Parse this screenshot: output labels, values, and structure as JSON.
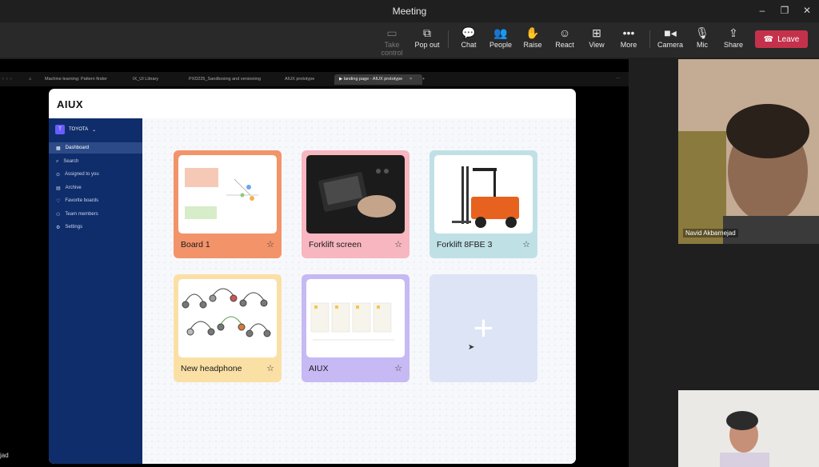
{
  "window": {
    "title": "Meeting",
    "controls": [
      "–",
      "❐",
      "✕"
    ]
  },
  "toolbar": {
    "take_control": "Take control",
    "pop_out": "Pop out",
    "chat": "Chat",
    "people": "People",
    "raise": "Raise",
    "react": "React",
    "view": "View",
    "more": "More",
    "camera": "Camera",
    "mic": "Mic",
    "share": "Share",
    "leave": "Leave"
  },
  "browser": {
    "tabs": [
      "Machine learning: Pattern finder",
      "IX_UI Library",
      "PXD225_Sandboxing and versioning",
      "AIUX prototype",
      "landing page - AIUX prototype"
    ],
    "new_tab": "+",
    "close": "×",
    "menu": "⋯"
  },
  "app": {
    "logo": "AIUX",
    "workspace": {
      "badge": "T",
      "name": "TOYOTA",
      "chevron": "⌄"
    },
    "nav": [
      {
        "label": "Dashboard",
        "icon": "grid-icon"
      },
      {
        "label": "Search",
        "icon": "search-icon"
      },
      {
        "label": "Assigned to you",
        "icon": "check-circle-icon"
      },
      {
        "label": "Archive",
        "icon": "archive-icon"
      },
      {
        "label": "Favorite boards",
        "icon": "heart-icon"
      },
      {
        "label": "Team members",
        "icon": "team-icon"
      },
      {
        "label": "Settings",
        "icon": "gear-icon"
      }
    ],
    "boards": [
      {
        "label": "Board 1",
        "color": "#f3936a"
      },
      {
        "label": "Forklift screen",
        "color": "#f7b6c0"
      },
      {
        "label": "Forklift 8FBE 3",
        "color": "#bfe1e6"
      },
      {
        "label": "New headphone",
        "color": "#fbe0a6"
      },
      {
        "label": "AIUX",
        "color": "#c7b9f4"
      }
    ],
    "add_board": "+"
  },
  "participants": [
    {
      "name": "Navid Akbarnejad"
    },
    {
      "name": "jad"
    }
  ],
  "colors": {
    "leave": "#c4314b",
    "sidebar": "#0f2d6b",
    "accent": "#6a5cff"
  }
}
